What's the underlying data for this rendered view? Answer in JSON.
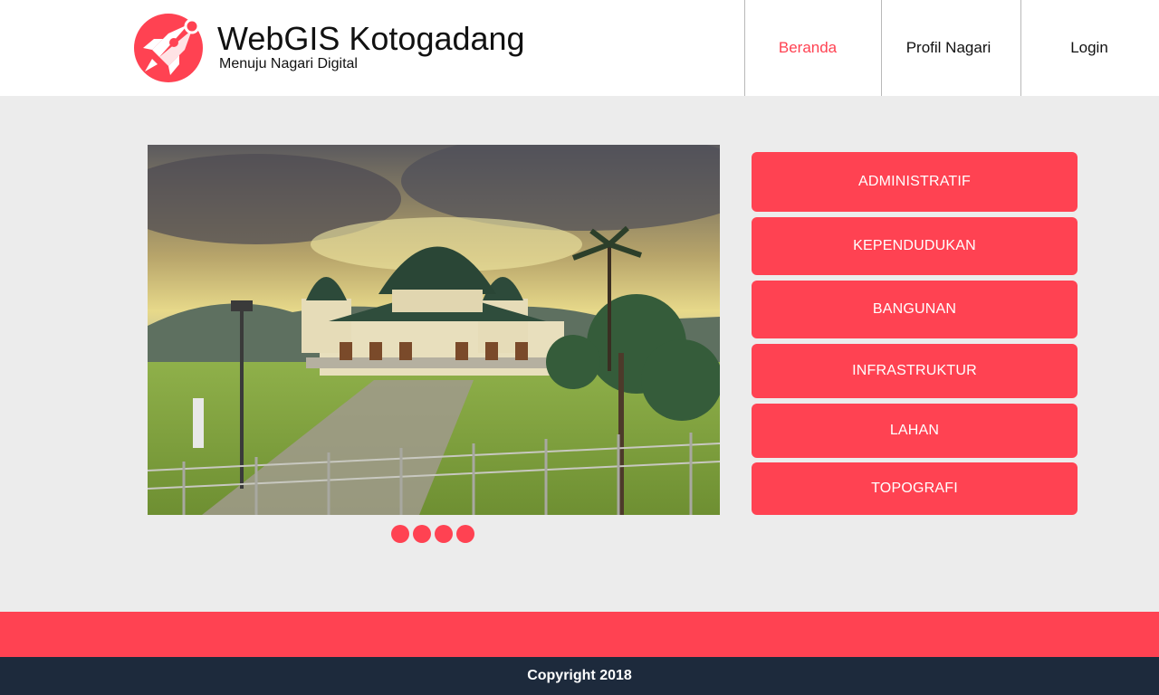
{
  "header": {
    "title": "WebGIS Kotogadang",
    "subtitle": "Menuju Nagari Digital",
    "logo_icon": "rocket-icon",
    "accent_color": "#ff4252"
  },
  "nav": {
    "items": [
      {
        "label": "Beranda",
        "active": true
      },
      {
        "label": "Profil Nagari",
        "active": false
      },
      {
        "label": "Login",
        "active": false
      }
    ]
  },
  "hero": {
    "image": "mosque-landscape-painting",
    "slide_count": 4
  },
  "menu": {
    "buttons": [
      {
        "label": "ADMINISTRATIF"
      },
      {
        "label": "KEPENDUDUKAN"
      },
      {
        "label": "BANGUNAN"
      },
      {
        "label": "INFRASTRUKTUR"
      },
      {
        "label": "LAHAN"
      },
      {
        "label": "TOPOGRAFI"
      }
    ],
    "button_color": "#ff4252"
  },
  "footer": {
    "copyright": "Copyright 2018",
    "band_color": "#ff4252",
    "bar_color": "#1d2a3c"
  }
}
